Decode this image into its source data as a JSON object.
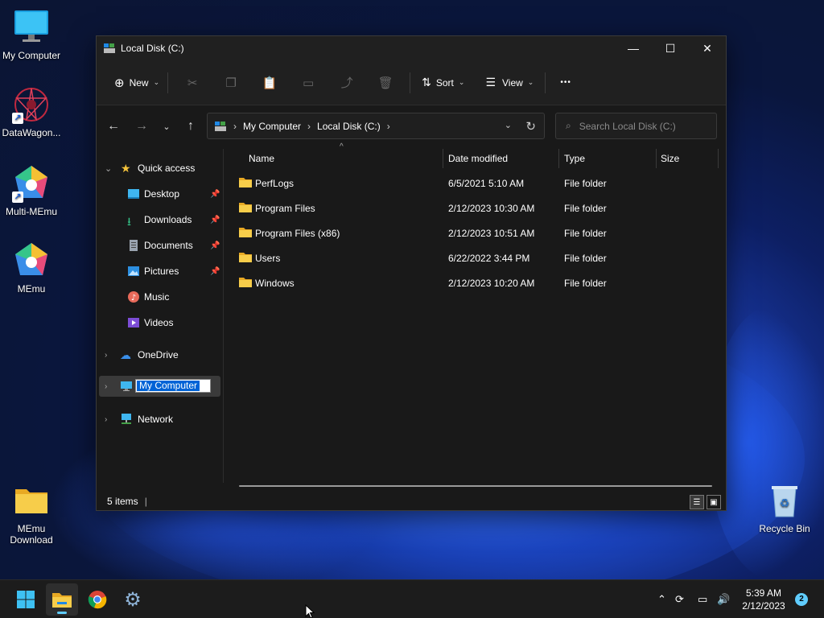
{
  "desktop": {
    "icons": [
      {
        "label": "My Computer"
      },
      {
        "label": "DataWagon..."
      },
      {
        "label": "Multi-MEmu"
      },
      {
        "label": "MEmu"
      },
      {
        "label": "MEmu Download"
      },
      {
        "label": "Recycle Bin"
      }
    ]
  },
  "window": {
    "title": "Local Disk (C:)",
    "toolbar": {
      "new_label": "New",
      "sort_label": "Sort",
      "view_label": "View",
      "more_label": "•••"
    },
    "address": {
      "crumbs": [
        "My Computer",
        "Local Disk (C:)"
      ],
      "separator": "›"
    },
    "search": {
      "placeholder": "Search Local Disk (C:)"
    },
    "sidebar": {
      "quick_access": "Quick access",
      "items": [
        {
          "label": "Desktop"
        },
        {
          "label": "Downloads"
        },
        {
          "label": "Documents"
        },
        {
          "label": "Pictures"
        },
        {
          "label": "Music"
        },
        {
          "label": "Videos"
        }
      ],
      "onedrive": "OneDrive",
      "my_computer_rename": "My Computer",
      "network": "Network"
    },
    "columns": {
      "name": "Name",
      "date": "Date modified",
      "type": "Type",
      "size": "Size"
    },
    "rows": [
      {
        "name": "PerfLogs",
        "date": "6/5/2021 5:10 AM",
        "type": "File folder"
      },
      {
        "name": "Program Files",
        "date": "2/12/2023 10:30 AM",
        "type": "File folder"
      },
      {
        "name": "Program Files (x86)",
        "date": "2/12/2023 10:51 AM",
        "type": "File folder"
      },
      {
        "name": "Users",
        "date": "6/22/2022 3:44 PM",
        "type": "File folder"
      },
      {
        "name": "Windows",
        "date": "2/12/2023 10:20 AM",
        "type": "File folder"
      }
    ],
    "status": {
      "items": "5 items",
      "divider": "|"
    }
  },
  "taskbar": {
    "time": "5:39 AM",
    "date": "2/12/2023",
    "notifications": "2"
  },
  "colors": {
    "accent": "#60cdff",
    "folder": "#f5c33b",
    "selection": "#0063d6"
  }
}
